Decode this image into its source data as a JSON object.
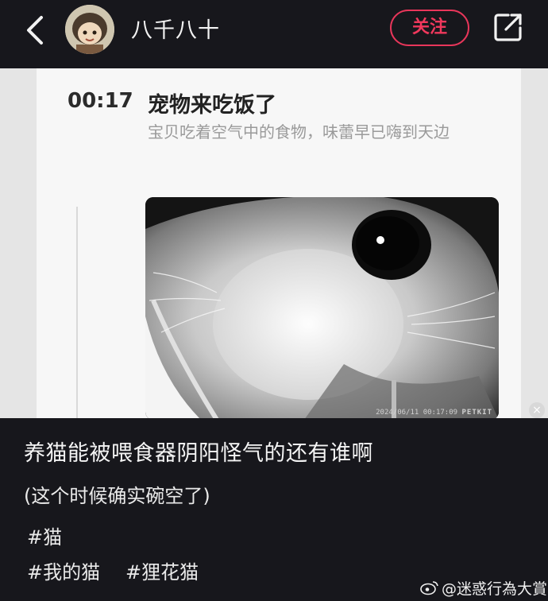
{
  "header": {
    "username": "八千八十",
    "follow_label": "关注"
  },
  "event": {
    "time": "00:17",
    "title": "宠物来吃饭了",
    "description": "宝贝吃着空气中的食物，味蕾早已嗨到天边",
    "photo_timestamp": "2024/06/11 00:17:09",
    "photo_brand": "PETKIT"
  },
  "post": {
    "title": "养猫能被喂食器阴阳怪气的还有谁啊",
    "body": "(这个时候确实碗空了)",
    "tags": [
      "#猫",
      "#我的猫",
      "#狸花猫"
    ]
  },
  "watermark": "@迷惑行為大賞",
  "colors": {
    "background": "#17171c",
    "follow_accent": "#e8365a",
    "card_bg": "#f7f7f7"
  },
  "icons": {
    "back": "chevron-left-icon",
    "share": "share-external-icon",
    "close": "close-icon",
    "weibo": "weibo-logo-icon"
  }
}
